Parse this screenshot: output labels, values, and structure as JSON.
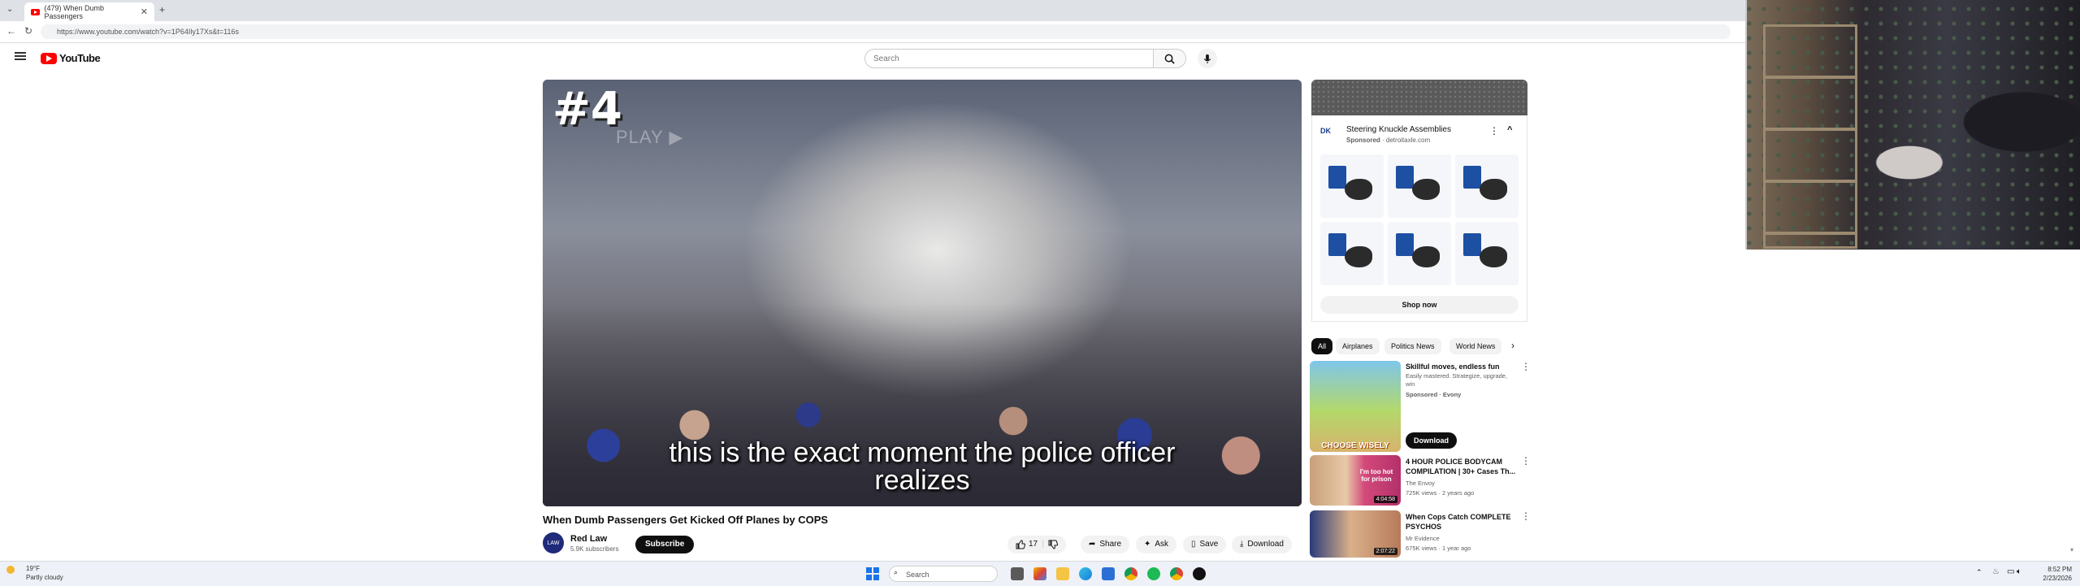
{
  "browser": {
    "tab_title": "(479) When Dumb Passengers",
    "new_tab": "+",
    "url": "https://www.youtube.com/watch?v=1P64Ily17Xs&t=116s"
  },
  "youtube": {
    "logo": "YouTube",
    "search_placeholder": "Search"
  },
  "video": {
    "overlay_rank": "#4",
    "overlay_play": "PLAY ▶",
    "caption_line1": "this is the exact moment the police officer",
    "caption_line2": "realizes",
    "title": "When Dumb Passengers Get Kicked Off Planes by COPS",
    "channel_avatar": "LAW",
    "channel": "Red Law",
    "subscribers": "5.9K subscribers",
    "subscribe": "Subscribe",
    "likes": "17",
    "share": "Share",
    "ask": "Ask",
    "save": "Save",
    "download": "Download"
  },
  "ad": {
    "logo": "DK",
    "title": "Steering Knuckle Assemblies",
    "sponsored": "Sponsored",
    "domain": "· detroitaxle.com",
    "cta": "Shop now",
    "collapse": "^"
  },
  "chips": [
    "All",
    "Airplanes",
    "Politics News",
    "World News"
  ],
  "recommendations": [
    {
      "title": "Skillful moves, endless fun",
      "meta1": "Easily mastered. Strategize, upgrade,",
      "meta2": "win",
      "meta3": "Sponsored · Evony",
      "cta": "Download",
      "thumb_text": "CHOOSE WISELY"
    },
    {
      "title": "4 HOUR POLICE BODYCAM COMPILATION | 30+ Cases Th...",
      "meta1": "The Envoy",
      "meta2": "725K views · 2 years ago",
      "thumb_text": "I'm too hot for prison",
      "duration": "4:04:58"
    },
    {
      "title": "When Cops Catch COMPLETE PSYCHOS",
      "meta1": "Mr Evidence",
      "meta2": "675K views · 1 year ago",
      "duration": "2:07:22"
    }
  ],
  "taskbar": {
    "weather_temp": "19°F",
    "weather_text": "Partly cloudy",
    "search": "Search",
    "time": "8:52 PM",
    "date": "2/23/2026"
  }
}
